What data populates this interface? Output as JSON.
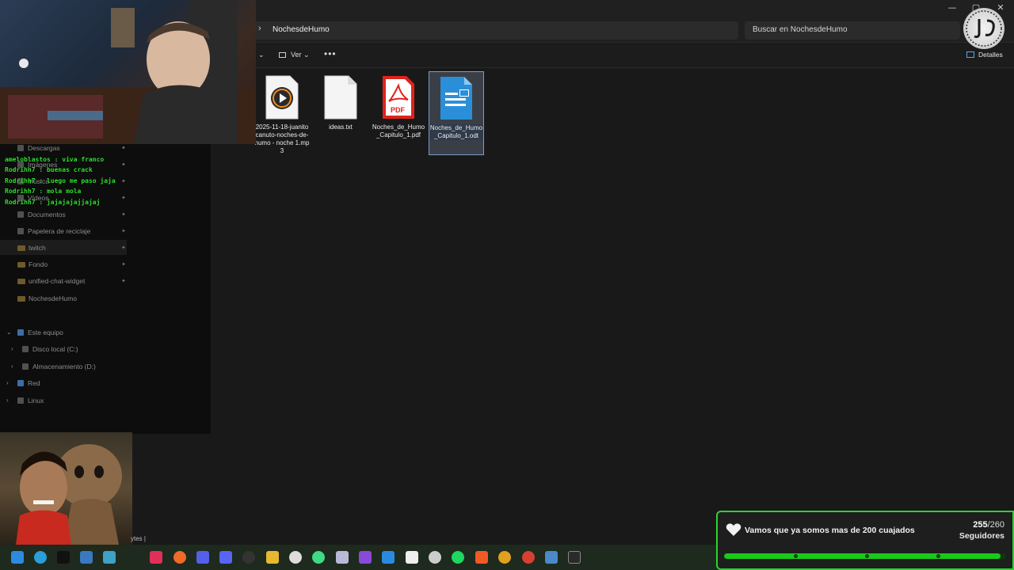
{
  "window": {
    "minimize": "—",
    "maximize": "▢",
    "close": "✕"
  },
  "address": {
    "path": "NochesdeHumo"
  },
  "search": {
    "placeholder": "Buscar en NochesdeHumo"
  },
  "toolbar": {
    "view_label": "Ver",
    "more": "•••",
    "details_label": "Detalles"
  },
  "files": [
    {
      "name": "2025-11-18-juanitocanuto-noches-de-humo - noche 1.mp3",
      "icon": "audio-file-icon"
    },
    {
      "name": "ideas.txt",
      "icon": "text-file-icon"
    },
    {
      "name": "Noches_de_Humo_Capitulo_1.pdf",
      "icon": "pdf-file-icon",
      "badge": "PDF"
    },
    {
      "name": "Noches_de_Humo_Capitulo_1.odt",
      "icon": "odt-file-icon",
      "selected": true
    }
  ],
  "sidebar": {
    "items": [
      {
        "label": "Descargas",
        "pinned": true
      },
      {
        "label": "Imágenes",
        "pinned": true
      },
      {
        "label": "Música",
        "pinned": true
      },
      {
        "label": "Vídeos",
        "pinned": true
      },
      {
        "label": "Documentos",
        "pinned": true
      },
      {
        "label": "Papelera de reciclaje",
        "pinned": true
      },
      {
        "label": "twitch",
        "pinned": true
      },
      {
        "label": "Fondo",
        "pinned": true
      },
      {
        "label": "unified-chat-widget",
        "pinned": true
      },
      {
        "label": "NochesdeHumo",
        "pinned": false
      }
    ],
    "this_pc": "Este equipo",
    "drives": [
      "Disco local (C:)",
      "Almacenamiento (D:)"
    ],
    "network": "Red",
    "linux": "Linux"
  },
  "chat": [
    {
      "user": "ameloblastos",
      "text": "viva franco"
    },
    {
      "user": "Rodrihh7",
      "text": "buenas crack"
    },
    {
      "user": "Rodrihh7",
      "text": "luego me paso jaja"
    },
    {
      "user": "Rodrihh7",
      "text": "mola mola"
    },
    {
      "user": "Rodrihh7",
      "text": "jajajajajjajaj"
    }
  ],
  "statusbar": {
    "text": "ytes  |"
  },
  "widget": {
    "message": "Vamos que ya somos mas de 200 cuajados",
    "current": "255",
    "goal": "/260",
    "label": "Seguidores",
    "progress": 0.98,
    "accent": "#19c919"
  },
  "taskbar": {
    "icons": [
      "windows-start-icon",
      "edge-icon",
      "capcut-icon",
      "monitor-icon",
      "snipping-icon",
      "intellij-icon",
      "postman-icon",
      "vivaldi-icon",
      "discord-icon",
      "obs-icon",
      "file-explorer-icon",
      "github-icon",
      "android-studio-icon",
      "box-icon",
      "visual-studio-icon",
      "vscode-icon",
      "notion-icon",
      "unity-icon",
      "spotify-icon",
      "brave-icon",
      "chrome-icon",
      "chrome-dev-icon",
      "pen-icon",
      "terminal-icon"
    ]
  }
}
